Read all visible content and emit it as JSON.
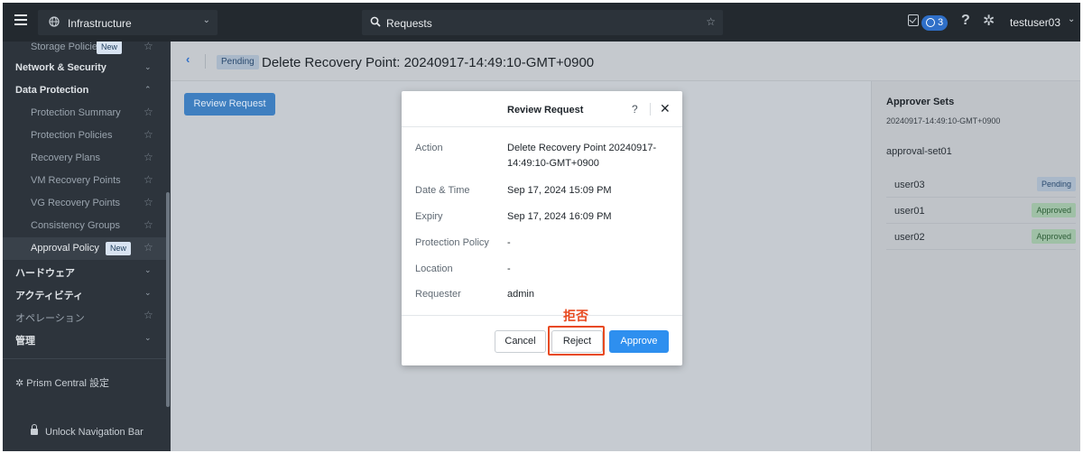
{
  "topbar": {
    "context_label": "Infrastructure",
    "search_text": "Requests",
    "alerts_count": "3",
    "help_glyph": "?",
    "username": "testuser03",
    "icons": [
      "menu-icon",
      "globe-icon",
      "chevron-down-icon",
      "search-icon",
      "star-icon",
      "tasks-icon",
      "alert-ring-icon",
      "help-icon",
      "gear-icon"
    ]
  },
  "sidebar": {
    "partial_item": "Storage Policies",
    "partial_badge": "New",
    "network_security": "Network & Security",
    "data_protection": "Data Protection",
    "dp_items": [
      "Protection Summary",
      "Protection Policies",
      "Recovery Plans",
      "VM Recovery Points",
      "VG Recovery Points",
      "Consistency Groups",
      "Approval Policy"
    ],
    "approval_badge": "New",
    "hardware": "ハードウェア",
    "activity": "アクティビティ",
    "operations": "オペレーション",
    "admin": "管理",
    "prism_settings": "Prism Central 設定",
    "unlock": "Unlock Navigation Bar"
  },
  "page": {
    "back_glyph": "‹",
    "status_tag": "Pending",
    "title": "Delete Recovery Point: 20240917-14:49:10-GMT+0900",
    "review_button": "Review Request"
  },
  "right_panel": {
    "title": "Approver Sets",
    "subtitle": "20240917-14:49:10-GMT+0900",
    "set_name": "approval-set01",
    "approvers": [
      {
        "user": "user03",
        "status": "Pending"
      },
      {
        "user": "user01",
        "status": "Approved"
      },
      {
        "user": "user02",
        "status": "Approved"
      }
    ]
  },
  "modal": {
    "title": "Review Request",
    "help": "?",
    "close": "✕",
    "fields": [
      {
        "label": "Action",
        "value": "Delete Recovery Point 20240917-14:49:10-GMT+0900"
      },
      {
        "label": "Date & Time",
        "value": "Sep 17, 2024 15:09 PM"
      },
      {
        "label": "Expiry",
        "value": "Sep 17, 2024 16:09 PM"
      },
      {
        "label": "Protection Policy",
        "value": "-"
      },
      {
        "label": "Location",
        "value": "-"
      },
      {
        "label": "Requester",
        "value": "admin"
      }
    ],
    "cancel": "Cancel",
    "reject": "Reject",
    "approve": "Approve"
  },
  "annotation": {
    "note": "拒否",
    "color": "#e8491f"
  },
  "colors": {
    "accent_blue": "#2e8fef",
    "topbar": "#23292f",
    "sidebar": "#2d343c"
  }
}
